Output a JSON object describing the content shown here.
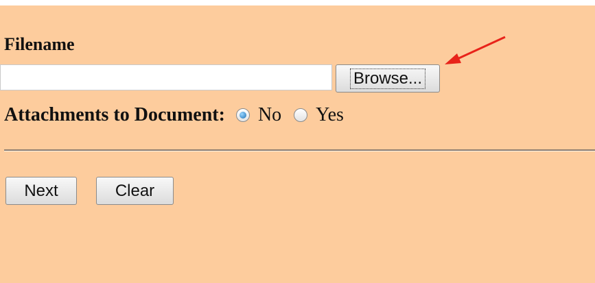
{
  "form": {
    "filename_label": "Filename",
    "filename_value": "",
    "browse_label": "Browse...",
    "attachments_label": "Attachments to Document:",
    "options": [
      {
        "label": "No",
        "checked": true
      },
      {
        "label": "Yes",
        "checked": false
      }
    ]
  },
  "actions": {
    "next_label": "Next",
    "clear_label": "Clear"
  },
  "annotation": {
    "arrow_color": "#e8231a",
    "icon": "red-arrow-icon"
  },
  "colors": {
    "background": "#fdcc9d"
  }
}
